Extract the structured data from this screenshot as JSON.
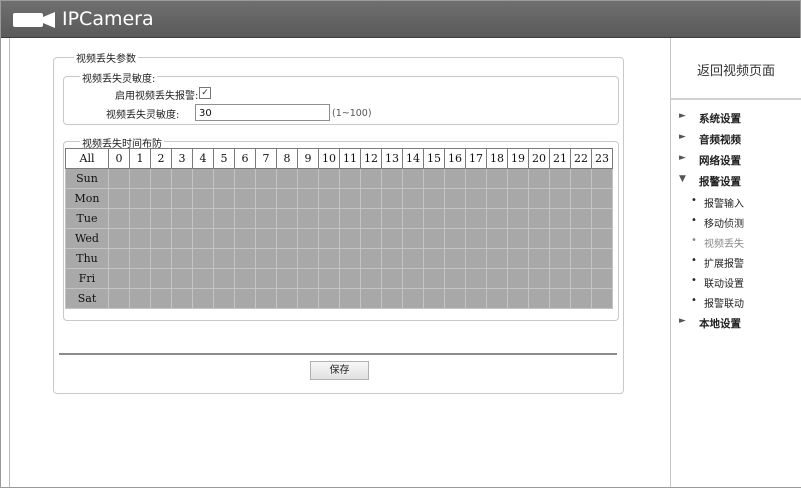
{
  "header": {
    "title": "IPCamera"
  },
  "form": {
    "legend": "视频丢失参数",
    "sensitivity": {
      "legend": "视频丢失灵敏度:",
      "enable_label": "启用视频丢失报警:",
      "enable_checked": true,
      "enable_mark": "✓",
      "level_label": "视频丢失灵敏度:",
      "level_value": "30",
      "range_hint": "(1~100)"
    },
    "schedule": {
      "legend": "视频丢失时间布防",
      "all_label": "All",
      "hours": [
        "0",
        "1",
        "2",
        "3",
        "4",
        "5",
        "6",
        "7",
        "8",
        "9",
        "10",
        "11",
        "12",
        "13",
        "14",
        "15",
        "16",
        "17",
        "18",
        "19",
        "20",
        "21",
        "22",
        "23"
      ],
      "days": [
        "Sun",
        "Mon",
        "Tue",
        "Wed",
        "Thu",
        "Fri",
        "Sat"
      ]
    },
    "save_label": "保存"
  },
  "sidebar": {
    "back_link": "返回视频页面",
    "menu": [
      {
        "label": "系统设置",
        "arrow": "►"
      },
      {
        "label": "音频视频",
        "arrow": "►"
      },
      {
        "label": "网络设置",
        "arrow": "►"
      },
      {
        "label": "报警设置",
        "arrow": "▼"
      },
      {
        "label": "本地设置",
        "arrow": "►"
      }
    ],
    "alarm_submenu": [
      {
        "label": "报警输入",
        "active": false
      },
      {
        "label": "移动侦测",
        "active": false
      },
      {
        "label": "视频丢失",
        "active": true
      },
      {
        "label": "扩展报警",
        "active": false
      },
      {
        "label": "联动设置",
        "active": false
      },
      {
        "label": "报警联动",
        "active": false
      }
    ]
  }
}
